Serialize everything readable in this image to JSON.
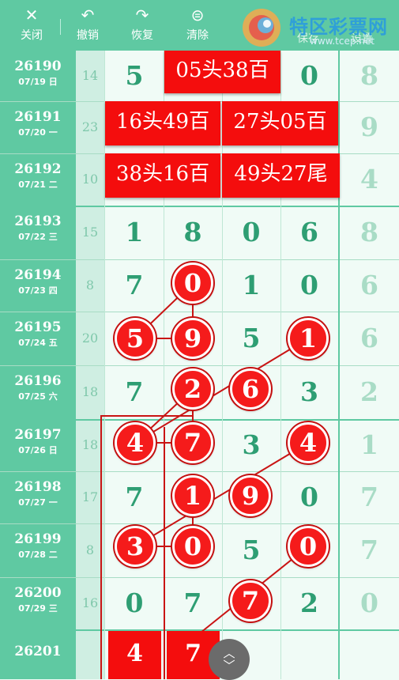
{
  "toolbar": {
    "close": {
      "label": "关闭",
      "icon": "✕"
    },
    "undo": {
      "label": "撤销",
      "icon": "↶"
    },
    "redo": {
      "label": "恢复",
      "icon": "↷"
    },
    "clear": {
      "label": "清除",
      "icon": "⊜"
    },
    "save": {
      "label": "保存"
    },
    "settings": {
      "label": "设置"
    }
  },
  "watermark": {
    "name": "特区彩票网",
    "url": "www.tcep.net"
  },
  "rows": [
    {
      "issue": "26190",
      "date": "07/19 日",
      "span": "14",
      "digits": [
        "5",
        "",
        "",
        "0"
      ],
      "last": "8"
    },
    {
      "issue": "26191",
      "date": "07/20 一",
      "span": "23",
      "digits": [
        "",
        "",
        "",
        ""
      ],
      "last": "9"
    },
    {
      "issue": "26192",
      "date": "07/21 二",
      "span": "10",
      "digits": [
        "",
        "",
        "",
        ""
      ],
      "last": "4"
    },
    {
      "issue": "26193",
      "date": "07/22 三",
      "span": "15",
      "digits": [
        "1",
        "8",
        "0",
        "6"
      ],
      "last": "8"
    },
    {
      "issue": "26194",
      "date": "07/23 四",
      "span": "8",
      "digits": [
        "7",
        "",
        "1",
        "0"
      ],
      "last": "6"
    },
    {
      "issue": "26195",
      "date": "07/24 五",
      "span": "20",
      "digits": [
        "",
        "",
        "5",
        ""
      ],
      "last": "6"
    },
    {
      "issue": "26196",
      "date": "07/25 六",
      "span": "18",
      "digits": [
        "7",
        "",
        "",
        "3"
      ],
      "last": "2"
    },
    {
      "issue": "26197",
      "date": "07/26 日",
      "span": "18",
      "digits": [
        "",
        "",
        "3",
        ""
      ],
      "last": "1"
    },
    {
      "issue": "26198",
      "date": "07/27 一",
      "span": "17",
      "digits": [
        "7",
        "",
        "",
        "0"
      ],
      "last": "7"
    },
    {
      "issue": "26199",
      "date": "07/28 二",
      "span": "8",
      "digits": [
        "",
        "",
        "5",
        ""
      ],
      "last": "7"
    },
    {
      "issue": "26200",
      "date": "07/29 三",
      "span": "16",
      "digits": [
        "0",
        "7",
        "",
        "2"
      ],
      "last": "0"
    },
    {
      "issue": "26201",
      "date": "",
      "span": "",
      "digits": [
        "",
        "",
        "",
        ""
      ],
      "last": ""
    }
  ],
  "red_boxes": [
    "05头38百",
    "16头49百",
    "27头05百",
    "38头16百",
    "49头27尾"
  ],
  "balls": [
    "0",
    "5",
    "9",
    "1",
    "2",
    "6",
    "4",
    "7",
    "4",
    "1",
    "9",
    "3",
    "0",
    "0",
    "7"
  ],
  "picks": [
    "4",
    "7"
  ],
  "colors": {
    "header": "#5fc9a2",
    "ball": "#f51b1b",
    "digit": "#2e9e73"
  }
}
